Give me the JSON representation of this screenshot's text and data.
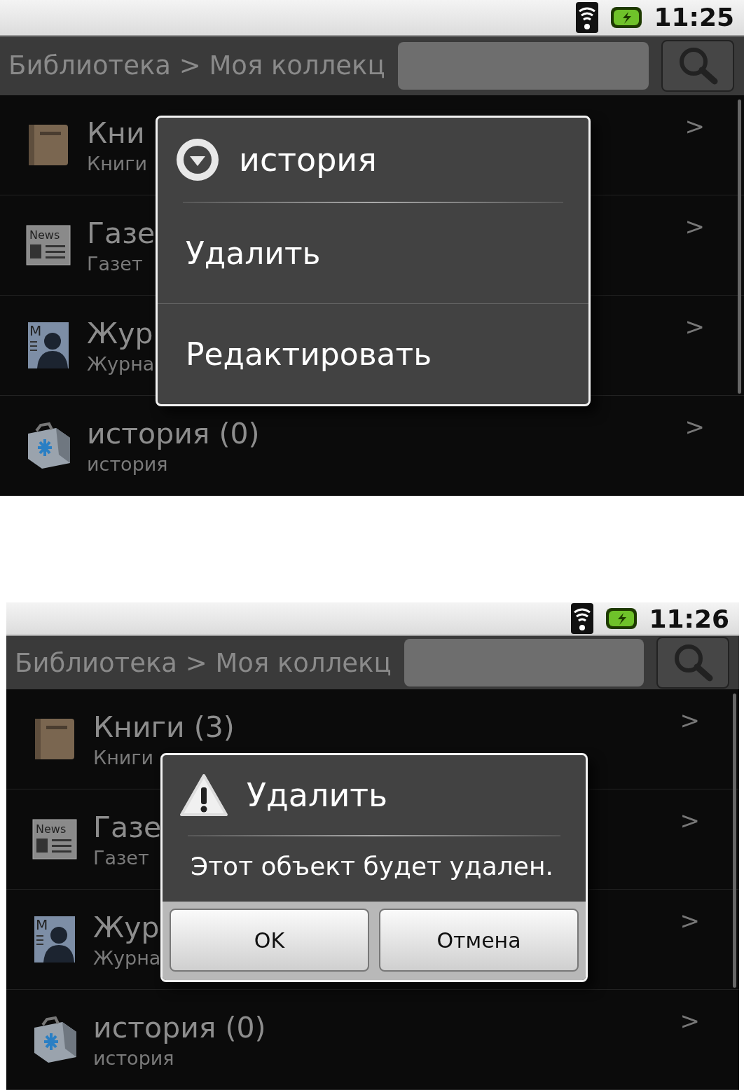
{
  "screens": [
    {
      "status_bar": {
        "time": "11:25"
      },
      "title_bar": {
        "breadcrumb": "Библиотека > Моя коллекц"
      },
      "list": [
        {
          "kind": "book",
          "title": "Кни",
          "subtitle": "Книги",
          "chevron": ">"
        },
        {
          "kind": "newspaper",
          "icon_label": "News",
          "title": "Газе",
          "subtitle": "Газет",
          "chevron": ">"
        },
        {
          "kind": "magazine",
          "icon_label": "M",
          "title": "Жур",
          "subtitle": "Журна",
          "chevron": ">"
        },
        {
          "kind": "briefcase",
          "title": "история (0)",
          "subtitle": "история",
          "chevron": ">"
        }
      ],
      "dialog": {
        "kind": "menu",
        "title": "история",
        "items": [
          "Удалить",
          "Редактировать"
        ]
      }
    },
    {
      "status_bar": {
        "time": "11:26"
      },
      "title_bar": {
        "breadcrumb": "Библиотека > Моя коллекц"
      },
      "list": [
        {
          "kind": "book",
          "title": "Книги (3)",
          "subtitle": "Книги",
          "chevron": ">"
        },
        {
          "kind": "newspaper",
          "icon_label": "News",
          "title": "Газе",
          "subtitle": "Газет",
          "chevron": ">"
        },
        {
          "kind": "magazine",
          "icon_label": "M",
          "title": "Жур",
          "subtitle": "Журна",
          "chevron": ">"
        },
        {
          "kind": "briefcase",
          "title": "история (0)",
          "subtitle": "история",
          "chevron": ">"
        }
      ],
      "dialog": {
        "kind": "alert",
        "title": "Удалить",
        "message": "Этот объект будет удален.",
        "buttons": [
          "OK",
          "Отмена"
        ]
      }
    }
  ]
}
